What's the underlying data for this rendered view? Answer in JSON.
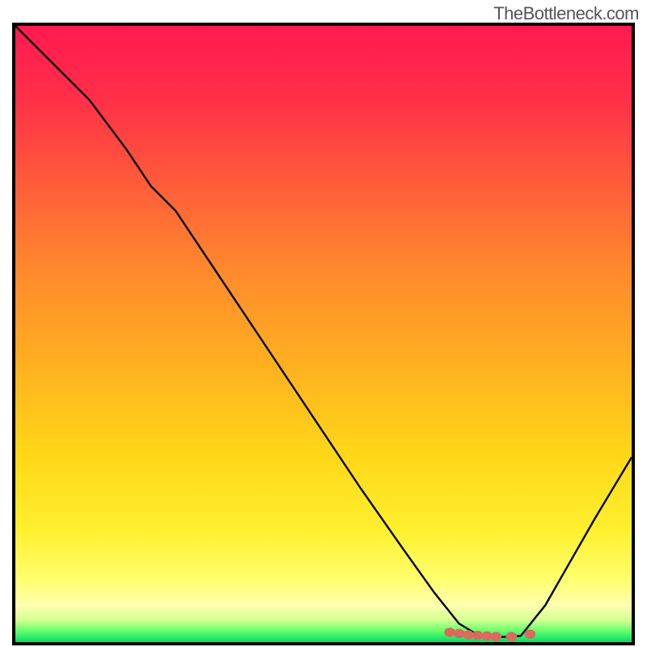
{
  "watermark": "TheBottleneck.com",
  "chart_data": {
    "type": "line",
    "title": "",
    "xlabel": "",
    "ylabel": "",
    "xlim": [
      0,
      100
    ],
    "ylim": [
      0,
      100
    ],
    "grid": false,
    "background_gradient_stops": [
      {
        "offset": 0.0,
        "color": "#ff1a50"
      },
      {
        "offset": 0.12,
        "color": "#ff3048"
      },
      {
        "offset": 0.25,
        "color": "#ff5a3a"
      },
      {
        "offset": 0.4,
        "color": "#ff8a2d"
      },
      {
        "offset": 0.55,
        "color": "#ffb020"
      },
      {
        "offset": 0.7,
        "color": "#ffd818"
      },
      {
        "offset": 0.82,
        "color": "#fff030"
      },
      {
        "offset": 0.9,
        "color": "#ffff70"
      },
      {
        "offset": 0.94,
        "color": "#ffffb0"
      },
      {
        "offset": 0.965,
        "color": "#d0ff90"
      },
      {
        "offset": 0.98,
        "color": "#70ff70"
      },
      {
        "offset": 1.0,
        "color": "#00e060"
      }
    ],
    "series": [
      {
        "name": "bottleneck-curve",
        "color": "#000000",
        "x": [
          0,
          6,
          12,
          18,
          22,
          26,
          32,
          40,
          48,
          56,
          63,
          68,
          72,
          75,
          78,
          82,
          86,
          90,
          94,
          100
        ],
        "y": [
          100,
          94,
          88,
          80,
          74,
          70,
          61,
          49,
          37,
          25,
          15,
          8,
          3,
          1.2,
          0.8,
          1.0,
          6,
          13,
          20,
          30
        ]
      }
    ],
    "markers": {
      "name": "bottom-markers",
      "color": "#d96a5c",
      "points": [
        {
          "x": 70.5,
          "y": 1.6
        },
        {
          "x": 72.0,
          "y": 1.4
        },
        {
          "x": 73.5,
          "y": 1.2
        },
        {
          "x": 75.0,
          "y": 1.1
        },
        {
          "x": 76.5,
          "y": 1.0
        },
        {
          "x": 78.0,
          "y": 0.9
        },
        {
          "x": 80.5,
          "y": 0.9
        },
        {
          "x": 83.5,
          "y": 1.3
        }
      ]
    }
  }
}
